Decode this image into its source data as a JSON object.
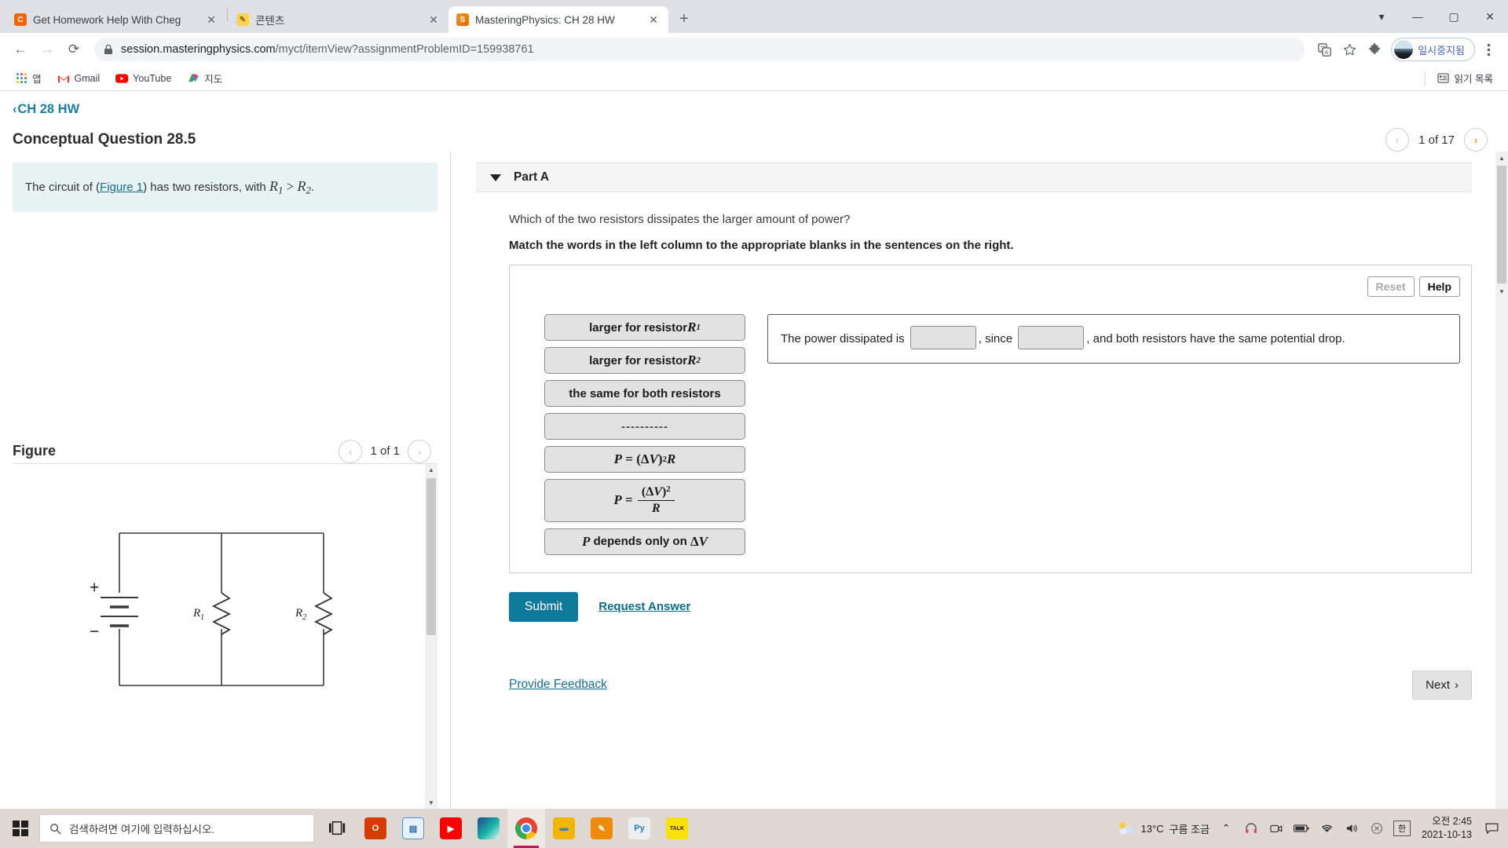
{
  "browser": {
    "tabs": [
      {
        "title": "Get Homework Help With Cheg",
        "favicon": "chegg-icon",
        "favicon_letter": "C",
        "active": false
      },
      {
        "title": "콘텐츠",
        "favicon": "note-icon",
        "favicon_letter": "✎",
        "active": false
      },
      {
        "title": "MasteringPhysics: CH 28 HW",
        "favicon": "mastering-physics-icon",
        "favicon_letter": "S",
        "active": true
      }
    ],
    "new_tab_label": "+",
    "window_controls": {
      "minimize": "—",
      "maximize": "▢",
      "close": "✕",
      "extra": "▾"
    },
    "nav": {
      "back": "←",
      "forward": "→",
      "reload": "⟳"
    },
    "url": {
      "lock": "lock-icon",
      "host": "session.masteringphysics.com",
      "path": "/myct/itemView?assignmentProblemID=159938761",
      "full": "session.masteringphysics.com/myct/itemView?assignmentProblemID=159938761"
    },
    "toolbar_icons": [
      "translate-icon",
      "bookmark-star-icon",
      "extensions-puzzle-icon"
    ],
    "profile": {
      "label": "일시중지됨"
    },
    "menu_icon": "three-dot-menu-icon",
    "bookmarks": [
      {
        "label": "앱",
        "icon": "apps-grid-icon"
      },
      {
        "label": "Gmail",
        "icon": "gmail-icon"
      },
      {
        "label": "YouTube",
        "icon": "youtube-icon"
      },
      {
        "label": "지도",
        "icon": "maps-icon"
      }
    ],
    "reading_list": {
      "label": "읽기 목록",
      "icon": "reading-list-icon"
    }
  },
  "mastering": {
    "breadcrumb": {
      "chevron": "‹",
      "label": "CH 28 HW"
    },
    "question_title": "Conceptual Question 28.5",
    "pager": {
      "prev": "‹",
      "label": "1 of 17",
      "next": "›"
    },
    "left": {
      "statement_pre": "The circuit of (",
      "statement_link": "Figure 1",
      "statement_mid": ") has two resistors, with ",
      "statement_r1": "R",
      "statement_r1_sub": "1",
      "statement_gt": " > ",
      "statement_r2": "R",
      "statement_r2_sub": "2",
      "statement_end": ".",
      "figure_title": "Figure",
      "figure_pager": {
        "prev": "‹",
        "label": "1 of 1",
        "next": "›"
      },
      "circuit": {
        "plus": "+",
        "minus": "−",
        "r1_label": "R",
        "r1_sub": "1",
        "r2_label": "R",
        "r2_sub": "2"
      }
    },
    "part": {
      "caret": "caret-down-icon",
      "label": "Part A",
      "question": "Which of the two resistors dissipates the larger amount of power?",
      "instruction": "Match the words in the left column to the appropriate blanks in the sentences on the right.",
      "reset_label": "Reset",
      "help_label": "Help",
      "tiles": [
        {
          "id": "tile-larger-r1",
          "type": "text-sub",
          "pre": "larger for resistor ",
          "mathit": "R",
          "sub": "1"
        },
        {
          "id": "tile-larger-r2",
          "type": "text-sub",
          "pre": "larger for resistor ",
          "mathit": "R",
          "sub": "2"
        },
        {
          "id": "tile-same-both",
          "type": "plain",
          "text": "the same for both resistors"
        },
        {
          "id": "tile-dashes",
          "type": "plain",
          "text": "----------"
        },
        {
          "id": "tile-p-dv2r",
          "type": "formula-1",
          "text": "P = (ΔV)²R"
        },
        {
          "id": "tile-p-dv2-over-r",
          "type": "formula-2",
          "text": "P = (ΔV)² / R"
        },
        {
          "id": "tile-p-depends",
          "type": "formula-3",
          "text": "P depends only on ΔV"
        }
      ],
      "sentence": {
        "part1": "The power dissipated is",
        "blank1": "",
        "part2": ", since",
        "blank2": "",
        "part3": ", and both resistors have the same potential drop."
      },
      "submit_label": "Submit",
      "request_answer_label": "Request Answer"
    },
    "footer": {
      "feedback_label": "Provide Feedback",
      "next_label": "Next",
      "next_chevron": "›"
    }
  },
  "taskbar": {
    "start_icon": "windows-start-icon",
    "search_placeholder": "검색하려면 여기에 입력하십시오.",
    "search_icon": "search-icon",
    "task_view_icon": "task-view-icon",
    "apps": [
      {
        "name": "office-icon",
        "glyph": "O",
        "color": "#d83b01",
        "active": false
      },
      {
        "name": "presentation-icon",
        "glyph": "▤",
        "color": "#4a90d9",
        "active": false
      },
      {
        "name": "youtube-icon",
        "glyph": "▶",
        "color": "#ff0000",
        "active": false
      },
      {
        "name": "whale-browser-icon",
        "glyph": "◗",
        "color": "#17b6a6",
        "active": false
      },
      {
        "name": "chrome-icon",
        "glyph": "◉",
        "color": "#4285f4",
        "active": true
      },
      {
        "name": "file-explorer-icon",
        "glyph": "🗀",
        "color": "#f2b600",
        "active": false
      },
      {
        "name": "editor-pencil-icon",
        "glyph": "✎",
        "color": "#f08a00",
        "active": false
      },
      {
        "name": "python-icon",
        "glyph": "🐍",
        "color": "#3776ab",
        "active": false
      },
      {
        "name": "kakaotalk-icon",
        "glyph": "TALK",
        "color": "#fae100",
        "active": false
      }
    ],
    "weather": {
      "icon": "partly-cloudy-icon",
      "temp": "13°C",
      "condition": "구름 조금"
    },
    "tray": [
      {
        "name": "show-hidden-icons-chevron",
        "glyph": "⌃"
      },
      {
        "name": "headset-icon",
        "glyph": "🎧"
      },
      {
        "name": "camera-icon",
        "glyph": "📷"
      },
      {
        "name": "battery-icon",
        "glyph": "▭"
      },
      {
        "name": "wifi-icon",
        "glyph": "📶"
      },
      {
        "name": "volume-icon",
        "glyph": "🔊"
      },
      {
        "name": "onedrive-paused-icon",
        "glyph": "⊗"
      }
    ],
    "ime": "한",
    "clock": {
      "time": "오전 2:45",
      "date": "2021-10-13"
    },
    "notification_icon": "notification-icon"
  }
}
